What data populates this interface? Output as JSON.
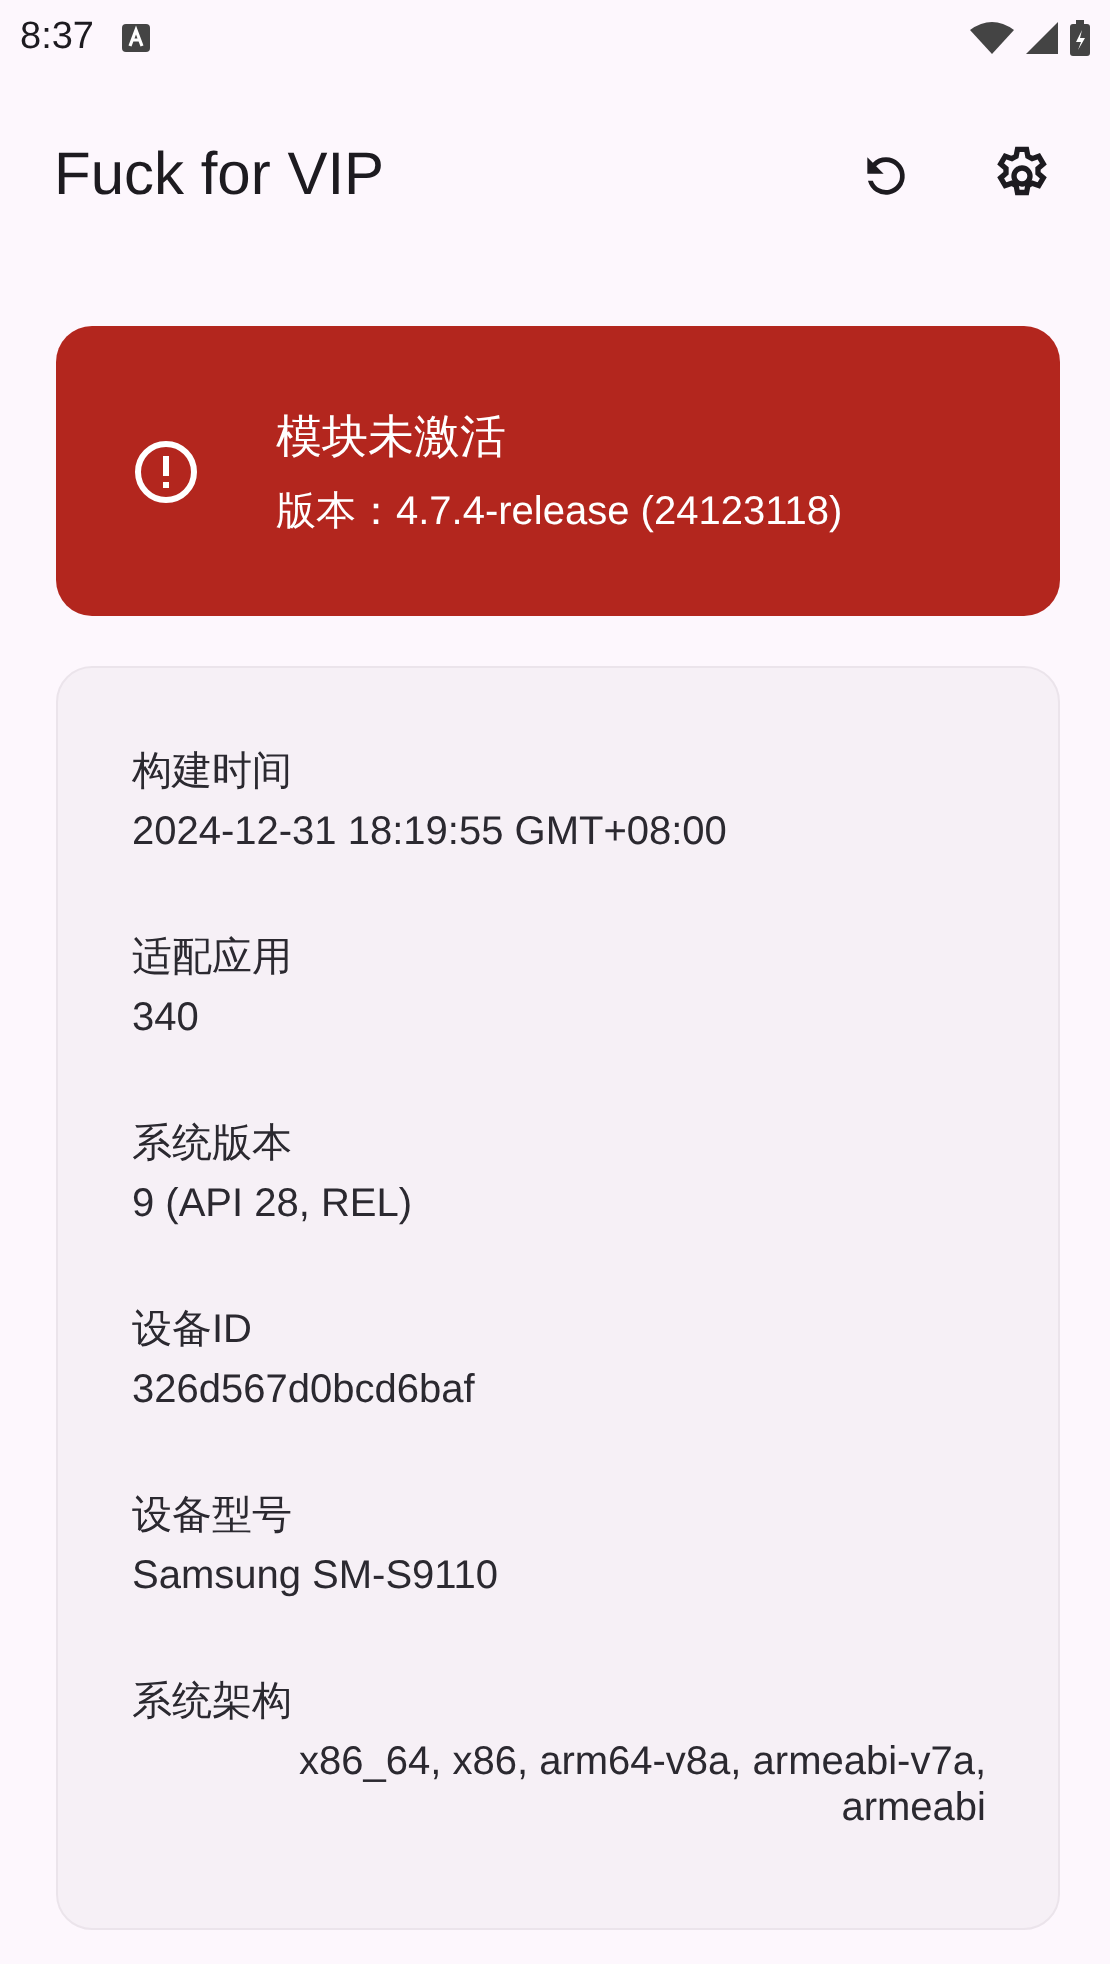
{
  "status_bar": {
    "time": "8:37"
  },
  "app_bar": {
    "title": "Fuck for VIP"
  },
  "module_status": {
    "active": false,
    "title": "模块未激活",
    "version": "版本：4.7.4-release (24123118)"
  },
  "info": [
    {
      "label": "构建时间",
      "value": "2024-12-31 18:19:55 GMT+08:00",
      "kind": "plain"
    },
    {
      "label": "适配应用",
      "value": "340",
      "kind": "plain"
    },
    {
      "label": "系统版本",
      "value": "9 (API 28, REL)",
      "kind": "plain"
    },
    {
      "label": "设备ID",
      "value": "326d567d0bcd6baf",
      "kind": "plain"
    },
    {
      "label": "设备型号",
      "value": "Samsung SM-S9110",
      "kind": "plain"
    },
    {
      "label": "系统架构",
      "value": "x86_64, x86, arm64-v8a, armeabi-v7a, armeabi",
      "kind": "right"
    }
  ]
}
